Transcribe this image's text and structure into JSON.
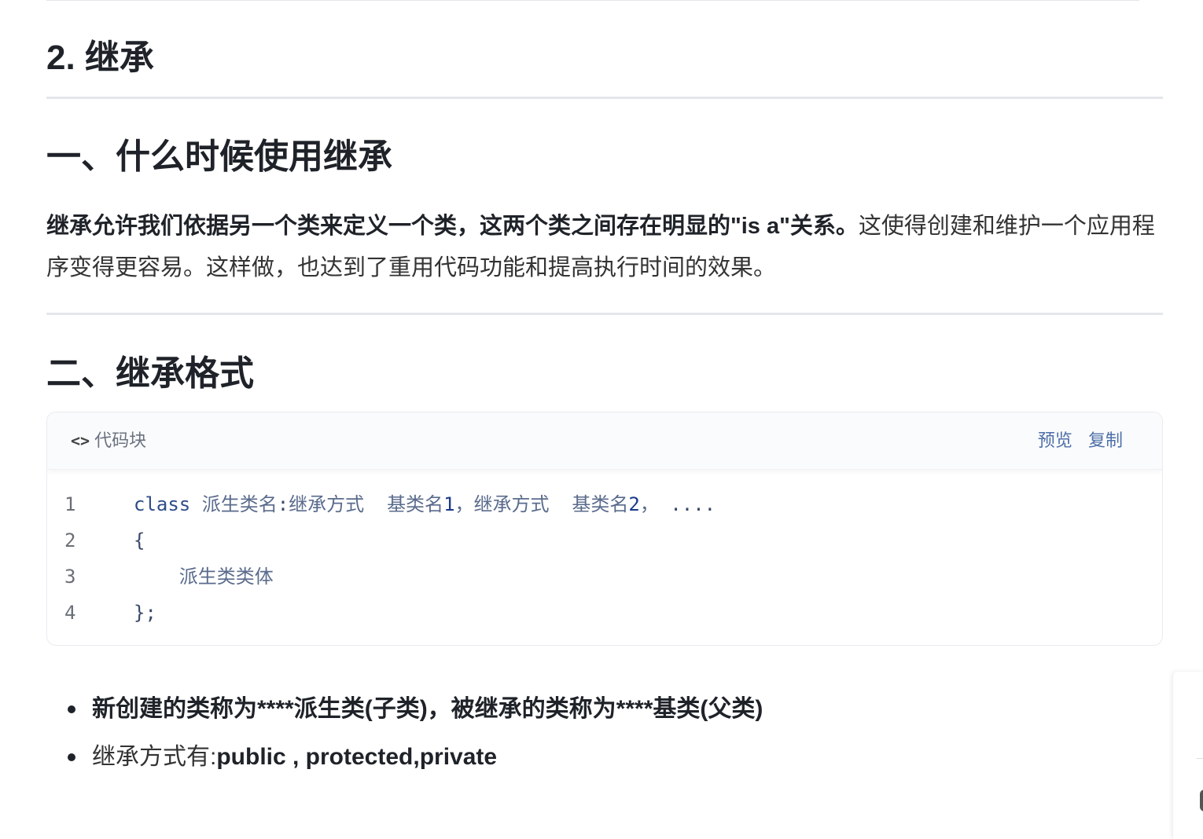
{
  "section_title": "2. 继承",
  "sections": [
    {
      "heading": "一、什么时候使用继承"
    },
    {
      "heading": "二、继承格式"
    }
  ],
  "intro": {
    "bold": "继承允许我们依据另一个类来定义一个类，这两个类之间存在明显的\"is a\"关系。",
    "normal": "这使得创建和维护一个应用程序变得更容易。这样做，也达到了重用代码功能和提高执行时间的效果。"
  },
  "code_block": {
    "label": "代码块",
    "label_icon": "code-brackets-icon",
    "actions": {
      "preview": "预览",
      "copy": "复制"
    },
    "lines": [
      {
        "num": "1",
        "parts": [
          {
            "t": "class",
            "c": "kw"
          },
          {
            "t": " ",
            "c": ""
          },
          {
            "t": "派生类名",
            "c": "cjk"
          },
          {
            "t": ":",
            "c": ""
          },
          {
            "t": "继承方式",
            "c": "cjk"
          },
          {
            "t": "  ",
            "c": ""
          },
          {
            "t": "基类名",
            "c": "cjk"
          },
          {
            "t": "1",
            "c": "num"
          },
          {
            "t": "，",
            "c": "cjk"
          },
          {
            "t": "继承方式",
            "c": "cjk"
          },
          {
            "t": "  ",
            "c": ""
          },
          {
            "t": "基类名",
            "c": "cjk"
          },
          {
            "t": "2",
            "c": "num"
          },
          {
            "t": "，",
            "c": "cjk"
          },
          {
            "t": " ....",
            "c": ""
          }
        ]
      },
      {
        "num": "2",
        "parts": [
          {
            "t": "{",
            "c": ""
          }
        ]
      },
      {
        "num": "3",
        "parts": [
          {
            "t": "    ",
            "c": ""
          },
          {
            "t": "派生类类体",
            "c": "cjk"
          }
        ]
      },
      {
        "num": "4",
        "parts": [
          {
            "t": "};",
            "c": ""
          }
        ]
      }
    ]
  },
  "bullets": [
    {
      "plain": "",
      "strong": "新创建的类称为****派生类(子类)，被继承的类称为****基类(父类)"
    },
    {
      "plain": "继承方式有:",
      "strong": "public , protected,private"
    }
  ]
}
